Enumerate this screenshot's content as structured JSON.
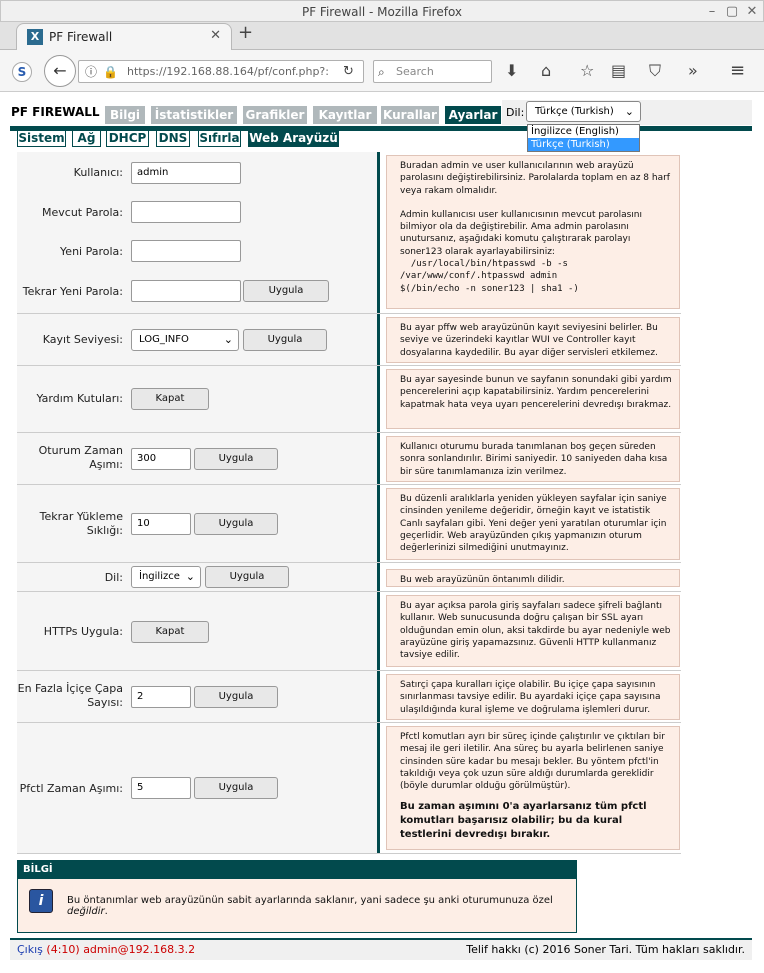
{
  "window": {
    "title": "PF Firewall - Mozilla Firefox"
  },
  "browser": {
    "tab_title": "PF Firewall",
    "url": "https://192.168.88.164/pf/conf.php?:",
    "search_placeholder": "Search"
  },
  "header": {
    "brand": "PF FIREWALL",
    "menu": [
      {
        "label": "Bilgi"
      },
      {
        "label": "İstatistikler"
      },
      {
        "label": "Grafikler"
      },
      {
        "label": "Kayıtlar"
      },
      {
        "label": "Kurallar"
      },
      {
        "label": "Ayarlar"
      }
    ],
    "active_menu": "Ayarlar",
    "lang_label": "Dil:",
    "lang_selected": "Türkçe (Turkish)",
    "lang_options": [
      "İngilizce (English)",
      "Türkçe (Turkish)"
    ]
  },
  "submenu": [
    {
      "label": "Sistem"
    },
    {
      "label": "Ağ"
    },
    {
      "label": "DHCP"
    },
    {
      "label": "DNS"
    },
    {
      "label": "Sıfırla"
    },
    {
      "label": "Web Arayüzü"
    }
  ],
  "password": {
    "user_label": "Kullanıcı:",
    "user_value": "admin",
    "current_label": "Mevcut Parola:",
    "new_label": "Yeni Parola:",
    "repeat_label": "Tekrar Yeni Parola:",
    "apply": "Uygula",
    "info_p1": "Buradan admin ve user kullanıcılarının web arayüzü parolasını değiştirebilirsiniz. Parolalarda toplam en az 8 harf veya rakam olmalıdır.",
    "info_p2": "Admin kullanıcısı user kullanıcısının mevcut parolasını bilmiyor ola da değiştirebilir. Ama admin parolasını unutursanız, aşağıdaki komutu çalıştırarak parolayı soner123 olarak ayarlayabilirsiniz:",
    "info_code": "  /usr/local/bin/htpasswd -b -s\n/var/www/conf/.htpasswd admin\n$(/bin/echo -n soner123 | sha1 -)"
  },
  "loglevel": {
    "label": "Kayıt Seviyesi:",
    "value": "LOG_INFO",
    "apply": "Uygula",
    "info": "Bu ayar pffw web arayüzünün kayıt seviyesini belirler. Bu seviye ve üzerindeki kayıtlar WUI ve Controller kayıt dosyalarına kaydedilir. Bu ayar diğer servisleri etkilemez."
  },
  "helpboxes": {
    "label": "Yardım Kutuları:",
    "button": "Kapat",
    "info": "Bu ayar sayesinde bunun ve sayfanın sonundaki gibi yardım pencerelerini açıp kapatabilirsiniz. Yardım pencerelerini kapatmak hata veya uyarı pencerelerini devredışı bırakmaz."
  },
  "session": {
    "label": "Oturum Zaman Aşımı:",
    "value": "300",
    "apply": "Uygula",
    "info": "Kullanıcı oturumu burada tanımlanan boş geçen süreden sonra sonlandırılır. Birimi saniyedir. 10 saniyeden daha kısa bir süre tanımlamanıza izin verilmez."
  },
  "reload": {
    "label": "Tekrar Yükleme Sıklığı:",
    "value": "10",
    "apply": "Uygula",
    "info": "Bu düzenli aralıklarla yeniden yükleyen sayfalar için saniye cinsinden yenileme değeridir, örneğin kayıt ve istatistik Canlı sayfaları gibi. Yeni değer yeni yaratılan oturumlar için geçerlidir. Web arayüzünden çıkış yapmanızın oturum değerlerinizi silmediğini unutmayınız."
  },
  "language": {
    "label": "Dil:",
    "value": "İngilizce",
    "apply": "Uygula",
    "info": "Bu web arayüzünün öntanımlı dilidir."
  },
  "https": {
    "label": "HTTPs Uygula:",
    "button": "Kapat",
    "info": "Bu ayar açıksa parola giriş sayfaları sadece şifreli bağlantı kullanır. Web sunucusunda doğru çalışan bir SSL ayarı olduğundan emin olun, aksi takdirde bu ayar nedeniyle web arayüzüne giriş yapamazsınız. Güvenli HTTP kullanmanız tavsiye edilir."
  },
  "anchor": {
    "label": "En Fazla İçiçe Çapa Sayısı:",
    "value": "2",
    "apply": "Uygula",
    "info": "Satırçi çapa kuralları içiçe olabilir. Bu içiçe çapa sayısının sınırlanması tavsiye edilir. Bu ayardaki içiçe çapa sayısına ulaşıldığında kural işleme ve doğrulama işlemleri durur."
  },
  "pfctl": {
    "label": "Pfctl Zaman Aşımı:",
    "value": "5",
    "apply": "Uygula",
    "info": "Pfctl komutları ayrı bir süreç içinde çalıştırılır ve çıktıları bir mesaj ile geri iletilir. Ana süreç bu ayarla belirlenen saniye cinsinden süre kadar bu mesajı bekler. Bu yöntem pfctl'in takıldığı veya çok uzun süre aldığı durumlarda gereklidir (böyle durumlar olduğu görülmüştür).",
    "warning": "Bu zaman aşımını 0'a ayarlarsanız tüm pfctl komutları başarısız olabilir; bu da kural testlerini devredışı bırakır."
  },
  "bilgi": {
    "title": "BİLGİ",
    "text": "Bu öntanımlar web arayüzünün sabit ayarlarında saklanır, yani sadece şu anki oturumunuza özel ",
    "emph": "değildir",
    "end": "."
  },
  "footer": {
    "logout": "Çıkış",
    "session": "(4:10) admin@192.168.3.2",
    "copyright": "Telif hakkı (c) 2016 Soner Tari. Tüm hakları saklıdır."
  }
}
